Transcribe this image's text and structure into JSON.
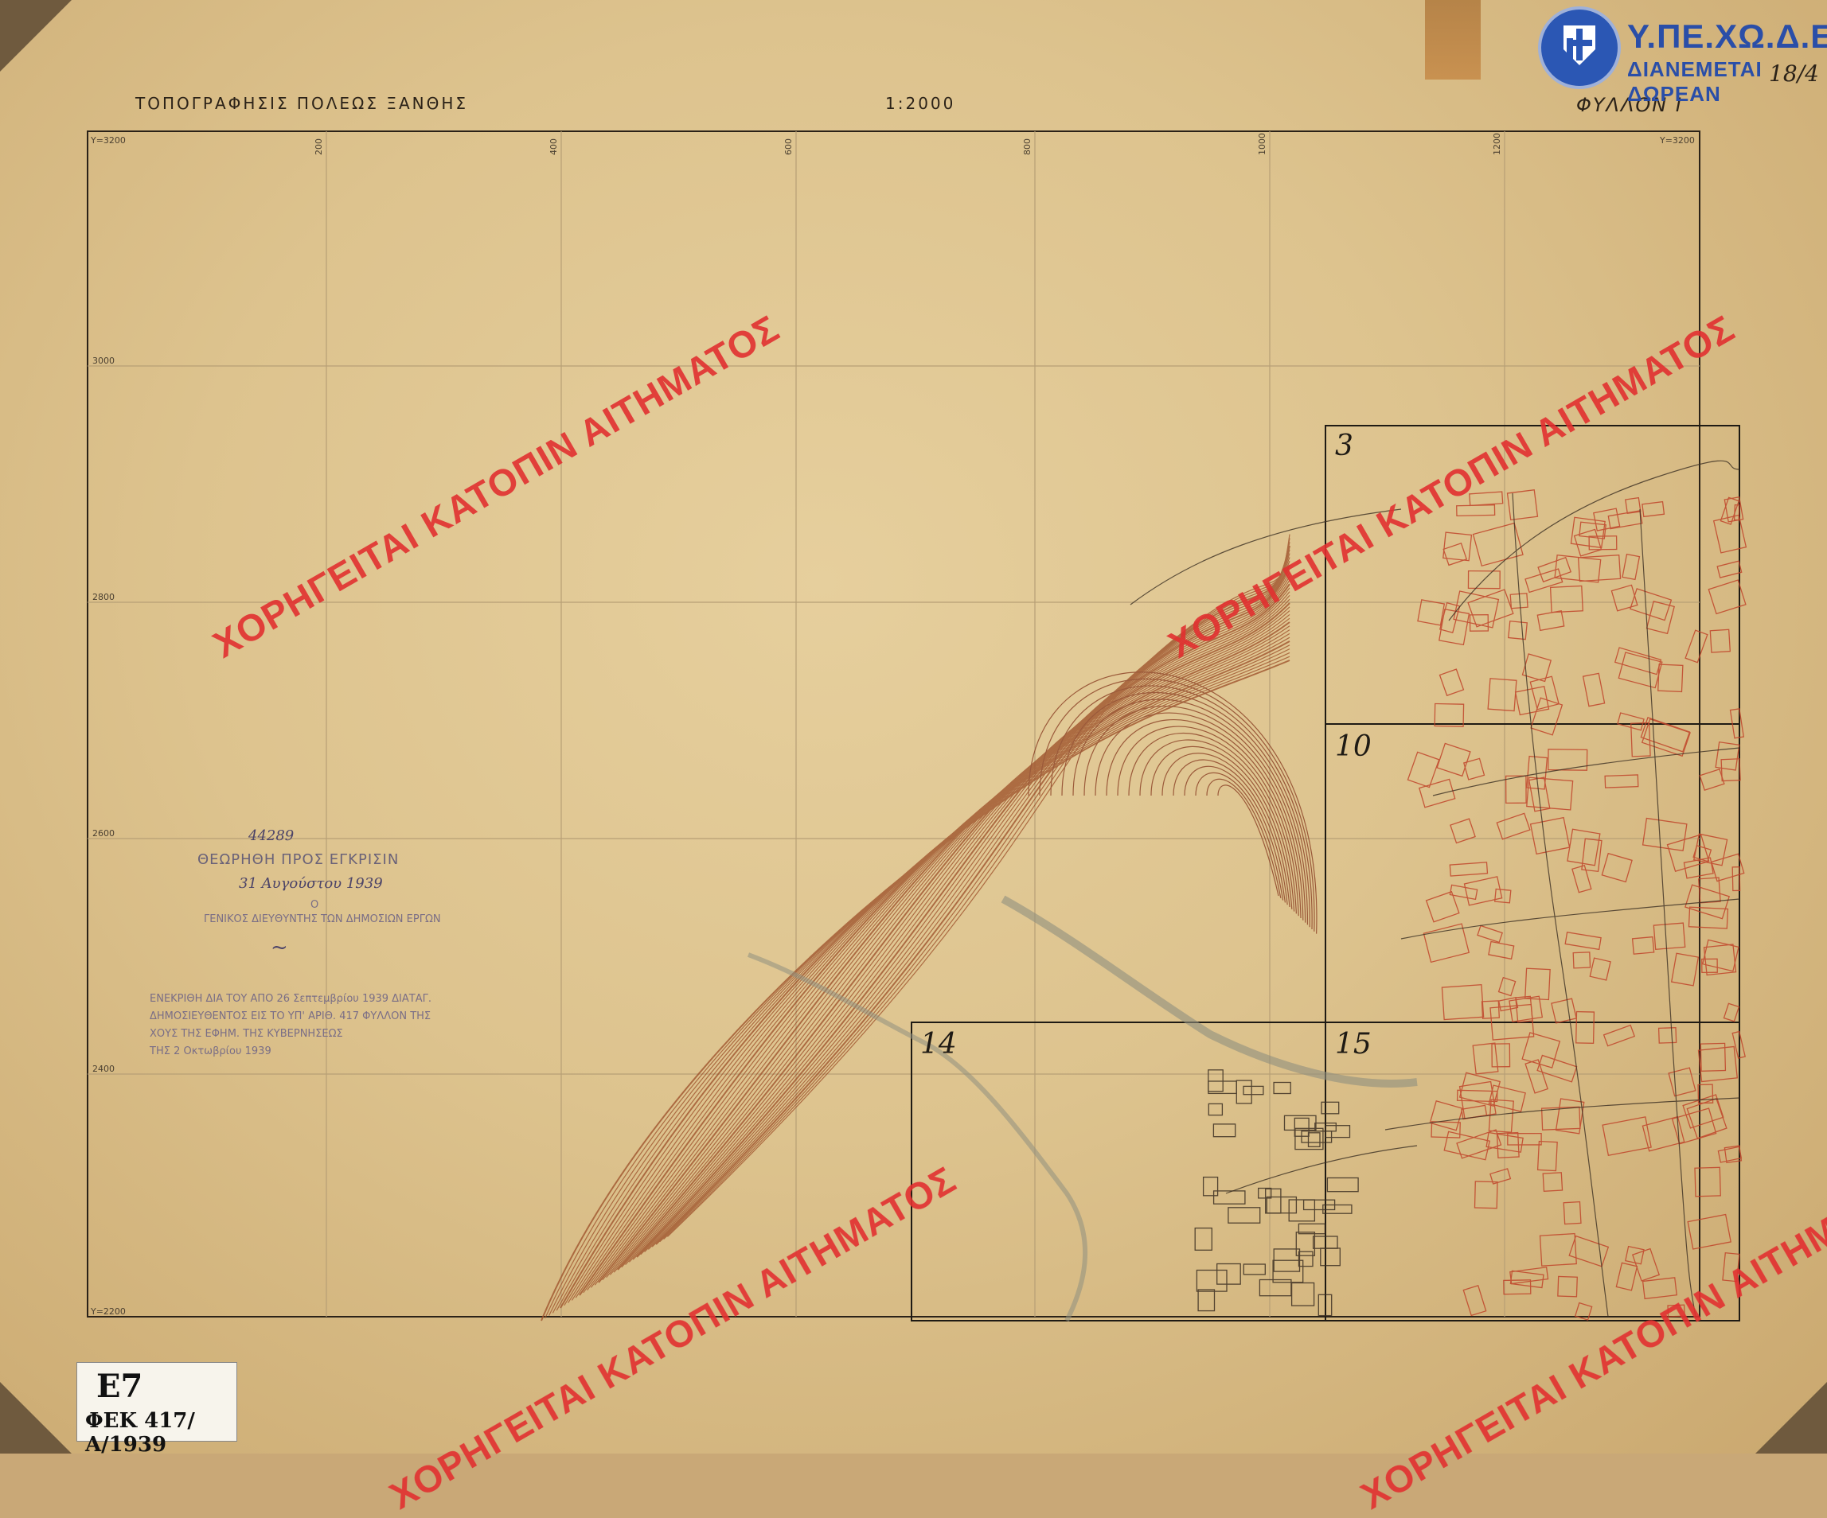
{
  "header": {
    "title": "ΤΟΠΟΓΡΑΦΗΣΙΣ ΠΟΛΕΩΣ ΞΑΝΘΗΣ",
    "scale": "1:2000",
    "sheet": "ΦΥΛΛΟΝ I"
  },
  "logo": {
    "title": "Υ.ΠΕ.ΧΩ.Δ.Ε",
    "subtitle": "ΔΙΑΝΕΜΕΤΑΙ ΔΩΡΕΑΝ",
    "sheet_fraction": "18/4"
  },
  "watermark": "ΧΟΡΗΓΕΙΤΑΙ ΚΑΤΟΠΙΝ ΑΙΤΗΜΑΤΟΣ",
  "tiles": [
    "3",
    "10",
    "14",
    "15"
  ],
  "stamp": {
    "number": "44289",
    "line1": "ΘΕΩΡΗΘΗ ΠΡΟΣ ΕΓΚΡΙΣΙΝ",
    "date1": "31 Αυγούστου 1939",
    "line2": "Ο",
    "line3": "ΓΕΝΙΚΟΣ ΔΙΕΥΘΥΝΤΗΣ ΤΩΝ ΔΗΜΟΣΙΩΝ ΕΡΓΩΝ",
    "approval1": "ΕΝΕΚΡΙΘΗ ΔΙΑ ΤΟΥ ΑΠΟ 26 Σεπτεμβρίου 1939 ΔΙΑΤΑΓ.",
    "approval2": "ΔΗΜΟΣΙΕΥΘΕΝΤΟΣ ΕΙΣ ΤΟ ΥΠ' ΑΡΙΘ. 417 ΦΥΛΛΟΝ ΤΗΣ",
    "approval3": "ΧΟΥΣ ΤΗΣ ΕΦΗΜ. ΤΗΣ ΚΥΒΕΡΝΗΣΕΩΣ",
    "approval4": "ΤΗΣ 2 Οκτωβρίου 1939"
  },
  "fek": {
    "code": "E7",
    "reference": "ΦΕΚ 417/Α/1939"
  },
  "grid": {
    "x_labels": [
      "200",
      "400",
      "600",
      "800",
      "1000",
      "1200"
    ],
    "y_labels": [
      "3000",
      "2800",
      "2600",
      "2400"
    ],
    "corner_tl": "Y=3200",
    "corner_tr": "Y=3200",
    "corner_bl": "Y=2200"
  },
  "colors": {
    "paper": "#ddc38e",
    "ink": "#2b2218",
    "contour": "#a0552e",
    "watermark": "#e23030",
    "logo": "#2a4ea8"
  }
}
